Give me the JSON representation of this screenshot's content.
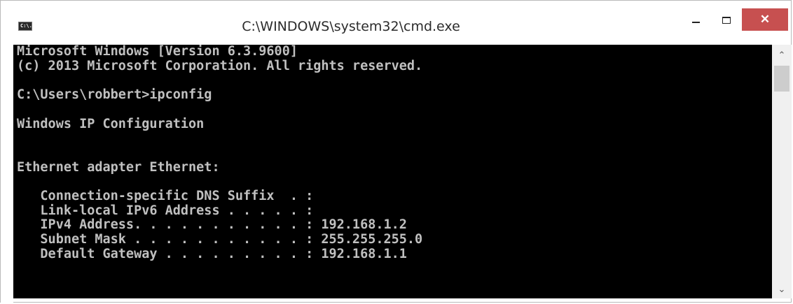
{
  "window": {
    "title": "C:\\WINDOWS\\system32\\cmd.exe",
    "app_icon_text": "C:\\.",
    "controls": {
      "minimize_icon": "minimize-icon",
      "maximize_icon": "maximize-icon",
      "close_label": "✕"
    }
  },
  "console": {
    "lines": [
      "Microsoft Windows [Version 6.3.9600]",
      "(c) 2013 Microsoft Corporation. All rights reserved.",
      "",
      "C:\\Users\\robbert>ipconfig",
      "",
      "Windows IP Configuration",
      "",
      "",
      "Ethernet adapter Ethernet:",
      "",
      "   Connection-specific DNS Suffix  . :",
      "   Link-local IPv6 Address . . . . . :",
      "   IPv4 Address. . . . . . . . . . . : 192.168.1.2",
      "   Subnet Mask . . . . . . . . . . . : 255.255.255.0",
      "   Default Gateway . . . . . . . . . : 192.168.1.1"
    ],
    "text_color": "#c0c0c0",
    "background_color": "#000000"
  },
  "scrollbar": {
    "up_arrow": "⌃",
    "down_arrow": "⌄"
  },
  "colors": {
    "close_button": "#c75050"
  }
}
